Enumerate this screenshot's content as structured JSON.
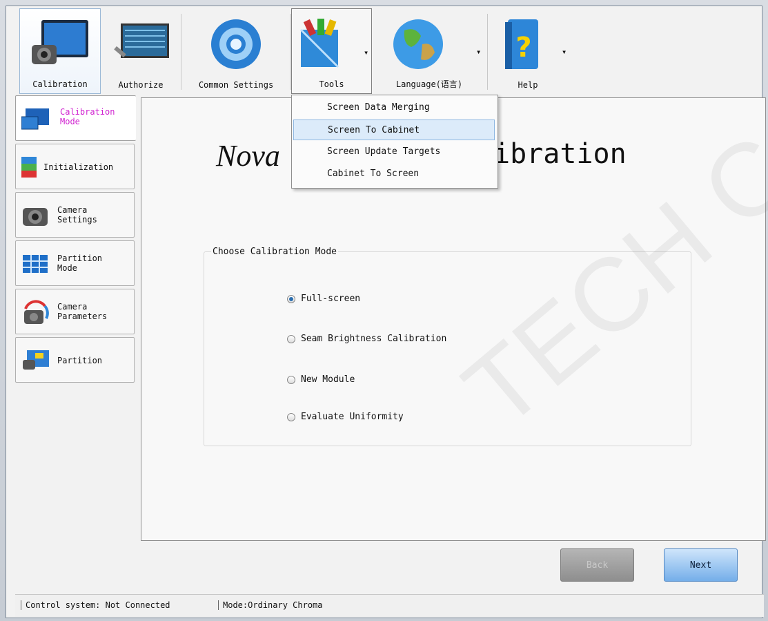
{
  "toolbar": {
    "calibration": "Calibration",
    "authorize": "Authorize",
    "common_settings": "Common Settings",
    "tools": "Tools",
    "language": "Language(语言)",
    "help": "Help"
  },
  "tools_menu": {
    "items": [
      "Screen Data Merging",
      "Screen To Cabinet",
      "Screen Update Targets",
      "Cabinet To Screen"
    ],
    "highlighted": "Screen To Cabinet"
  },
  "sidebar": {
    "items": [
      {
        "label1": "Calibration",
        "label2": "Mode"
      },
      {
        "label1": "Initialization",
        "label2": ""
      },
      {
        "label1": "Camera",
        "label2": "Settings"
      },
      {
        "label1": "Partition",
        "label2": "Mode"
      },
      {
        "label1": "Camera",
        "label2": "Parameters"
      },
      {
        "label1": "Partition",
        "label2": ""
      }
    ]
  },
  "main": {
    "title_left": "Nova",
    "title_right": "ibration",
    "group_title": "Choose Calibration Mode",
    "options": [
      "Full-screen",
      "Seam Brightness Calibration",
      "New Module",
      "Evaluate Uniformity"
    ],
    "selected_option": "Full-screen"
  },
  "buttons": {
    "back": "Back",
    "next": "Next"
  },
  "status": {
    "control": "Control system: Not Connected",
    "mode": "Mode:Ordinary Chroma"
  },
  "watermark": "TECH CO.,LTD",
  "colors": {
    "accent": "#d020d0",
    "next_button": "#74aee9",
    "highlight": "#dcebfa"
  }
}
